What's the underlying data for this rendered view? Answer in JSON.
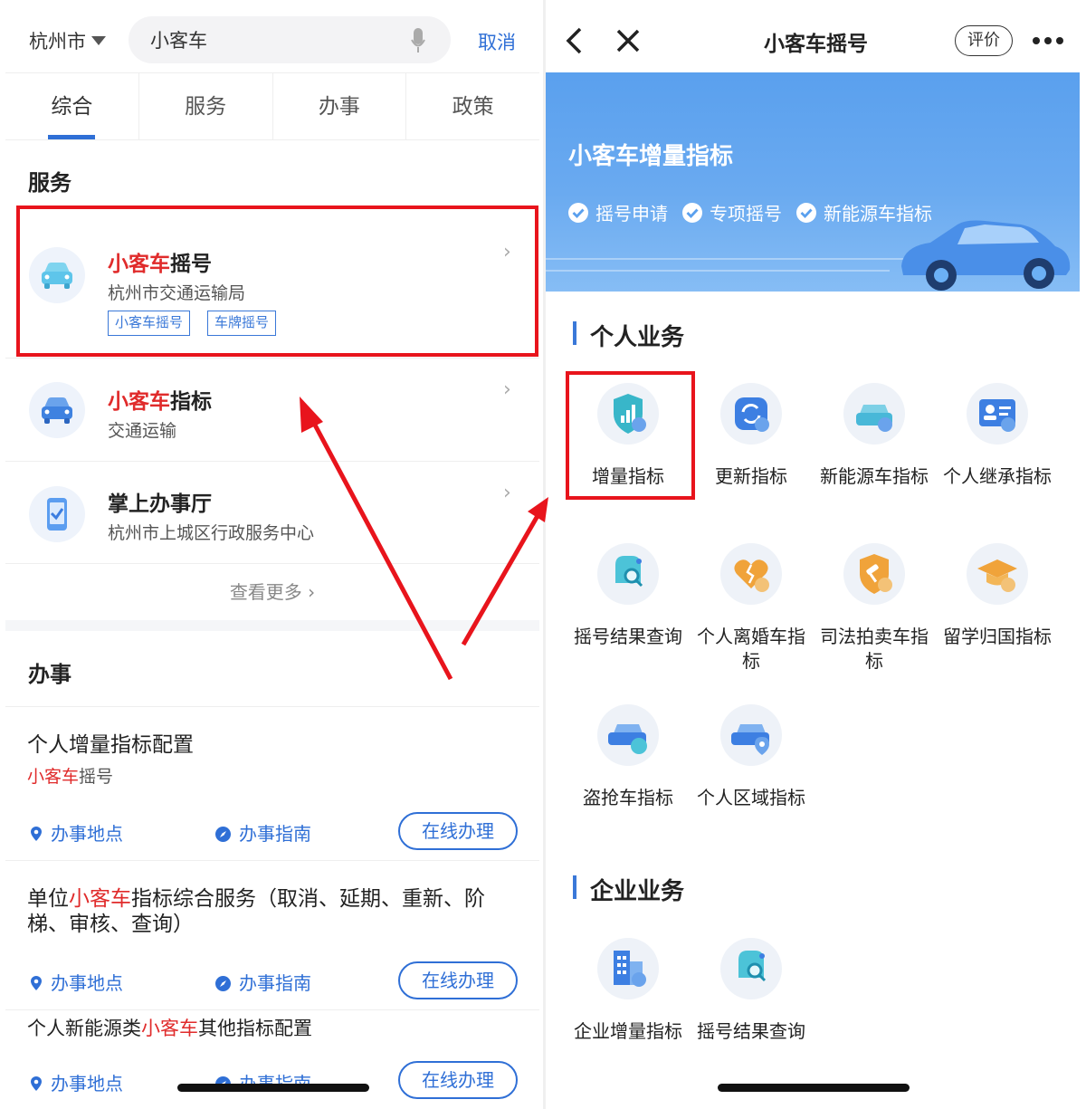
{
  "left": {
    "city": "杭州市",
    "search": {
      "value": "小客车",
      "cancel": "取消"
    },
    "tabs": [
      "综合",
      "服务",
      "办事",
      "政策"
    ],
    "service_section_title": "服务",
    "services": [
      {
        "title_hl": "小客车",
        "title_rest": "摇号",
        "sub": "杭州市交通运输局",
        "tags": [
          "小客车摇号",
          "车牌摇号"
        ]
      },
      {
        "title_hl": "小客车",
        "title_rest": "指标",
        "sub": "交通运输"
      },
      {
        "title_hl": "",
        "title_rest": "掌上办事厅",
        "sub": "杭州市上城区行政服务中心"
      }
    ],
    "more_label": "查看更多",
    "tasks_section_title": "办事",
    "tasks": [
      {
        "title_a": "个人增量指标配置",
        "title_hl": "",
        "title_b": "",
        "sub_hl": "小客车",
        "sub_rest": "摇号",
        "place": "办事地点",
        "guide": "办事指南",
        "online": "在线办理"
      },
      {
        "title_a": "单位",
        "title_hl": "小客车",
        "title_b": "指标综合服务（取消、延期、重新、阶梯、审核、查询）",
        "place": "办事地点",
        "guide": "办事指南",
        "online": "在线办理"
      },
      {
        "title_a": "个人新能源类",
        "title_hl": "小客车",
        "title_b": "其他指标配置",
        "place": "办事地点",
        "guide": "办事指南",
        "online": "在线办理"
      }
    ],
    "accent": "#2f6fd6",
    "highlight_color": "#e02b2b"
  },
  "right": {
    "nav_title": "小客车摇号",
    "rate_label": "评价",
    "banner": {
      "title": "小客车增量指标",
      "tags": [
        "摇号申请",
        "专项摇号",
        "新能源车指标"
      ]
    },
    "personal_title": "个人业务",
    "personal_items": [
      {
        "label": "增量指标",
        "icon": "shield-chart-icon"
      },
      {
        "label": "更新指标",
        "icon": "refresh-icon"
      },
      {
        "label": "新能源车指标",
        "icon": "ev-car-icon"
      },
      {
        "label": "个人继承指标",
        "icon": "id-card-icon"
      },
      {
        "label": "摇号结果查询",
        "icon": "search-doc-icon"
      },
      {
        "label": "个人离婚车指标",
        "icon": "broken-heart-icon"
      },
      {
        "label": "司法拍卖车指标",
        "icon": "gavel-shield-icon"
      },
      {
        "label": "留学归国指标",
        "icon": "graduation-cap-icon"
      },
      {
        "label": "盗抢车指标",
        "icon": "stolen-car-icon"
      },
      {
        "label": "个人区域指标",
        "icon": "car-location-icon"
      }
    ],
    "enterprise_title": "企业业务",
    "enterprise_items": [
      {
        "label": "企业增量指标",
        "icon": "building-icon"
      },
      {
        "label": "摇号结果查询",
        "icon": "search-doc-icon"
      }
    ],
    "banner_color": "#5aa0ee"
  },
  "annotation_color": "#e8141c"
}
